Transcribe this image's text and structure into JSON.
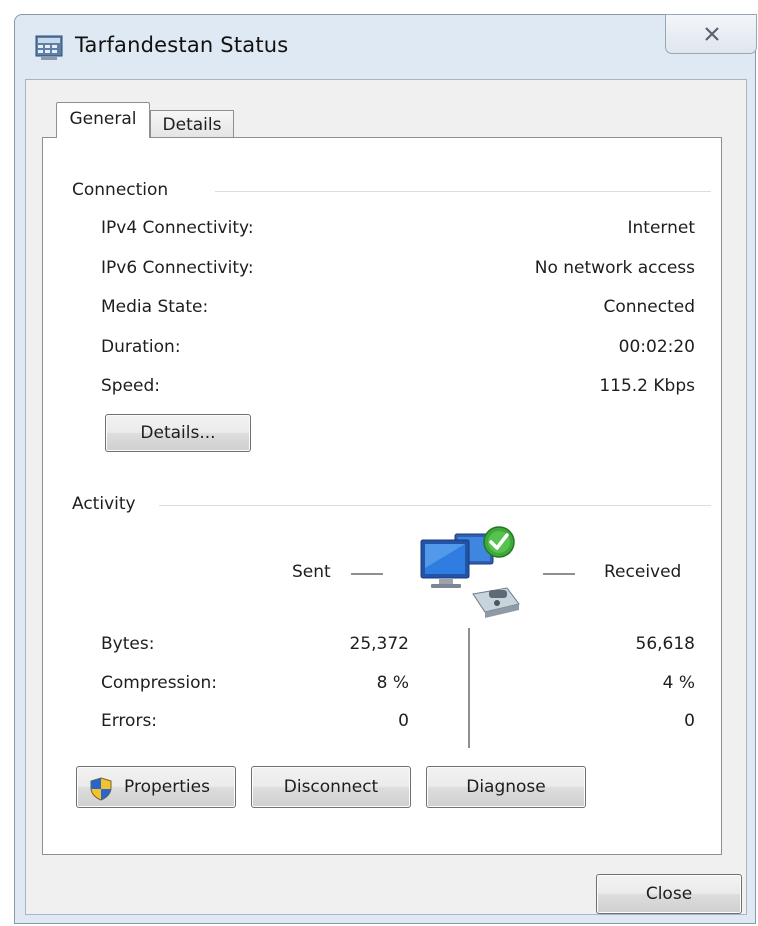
{
  "window": {
    "title": "Tarfandestan Status",
    "icons": {
      "app": "network-connection-icon",
      "close": "close-icon"
    }
  },
  "tabs": [
    {
      "label": "General",
      "selected": true
    },
    {
      "label": "Details",
      "selected": false
    }
  ],
  "connection": {
    "group_label": "Connection",
    "rows": [
      {
        "label": "IPv4 Connectivity:",
        "value": "Internet"
      },
      {
        "label": "IPv6 Connectivity:",
        "value": "No network access"
      },
      {
        "label": "Media State:",
        "value": "Connected"
      },
      {
        "label": "Duration:",
        "value": "00:02:20"
      },
      {
        "label": "Speed:",
        "value": "115.2 Kbps"
      }
    ],
    "details_button": "Details..."
  },
  "activity": {
    "group_label": "Activity",
    "sent_label": "Sent",
    "received_label": "Received",
    "network_icon": "network-activity-icon",
    "rows": [
      {
        "label": "Bytes:",
        "sent": "25,372",
        "received": "56,618"
      },
      {
        "label": "Compression:",
        "sent": "8 %",
        "received": "4 %"
      },
      {
        "label": "Errors:",
        "sent": "0",
        "received": "0"
      }
    ]
  },
  "buttons": {
    "properties": "Properties",
    "properties_icon": "uac-shield-icon",
    "disconnect": "Disconnect",
    "diagnose": "Diagnose",
    "close": "Close"
  }
}
